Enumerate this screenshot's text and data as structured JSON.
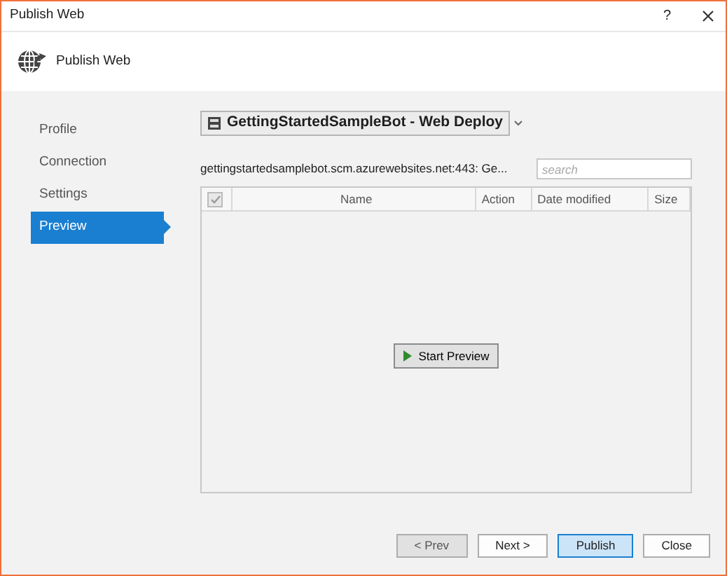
{
  "window": {
    "title": "Publish Web",
    "help": "?"
  },
  "header": {
    "title": "Publish Web"
  },
  "sidebar": {
    "items": [
      {
        "label": "Profile",
        "selected": false
      },
      {
        "label": "Connection",
        "selected": false
      },
      {
        "label": "Settings",
        "selected": false
      },
      {
        "label": "Preview",
        "selected": true
      }
    ]
  },
  "profile_dropdown": {
    "value": "GettingStartedSampleBot - Web Deploy"
  },
  "server_label": "gettingstartedsamplebot.scm.azurewebsites.net:443: Ge...",
  "search": {
    "placeholder": "search"
  },
  "grid": {
    "select_all": {
      "checked": true,
      "disabled": true
    },
    "columns": [
      "Name",
      "Action",
      "Date modified",
      "Size"
    ]
  },
  "start_preview": {
    "label": "Start Preview"
  },
  "buttons": [
    {
      "label": "< Prev",
      "kind": "disabled"
    },
    {
      "label": "Next >",
      "kind": "normal"
    },
    {
      "label": "Publish",
      "kind": "default"
    },
    {
      "label": "Close",
      "kind": "normal"
    }
  ]
}
